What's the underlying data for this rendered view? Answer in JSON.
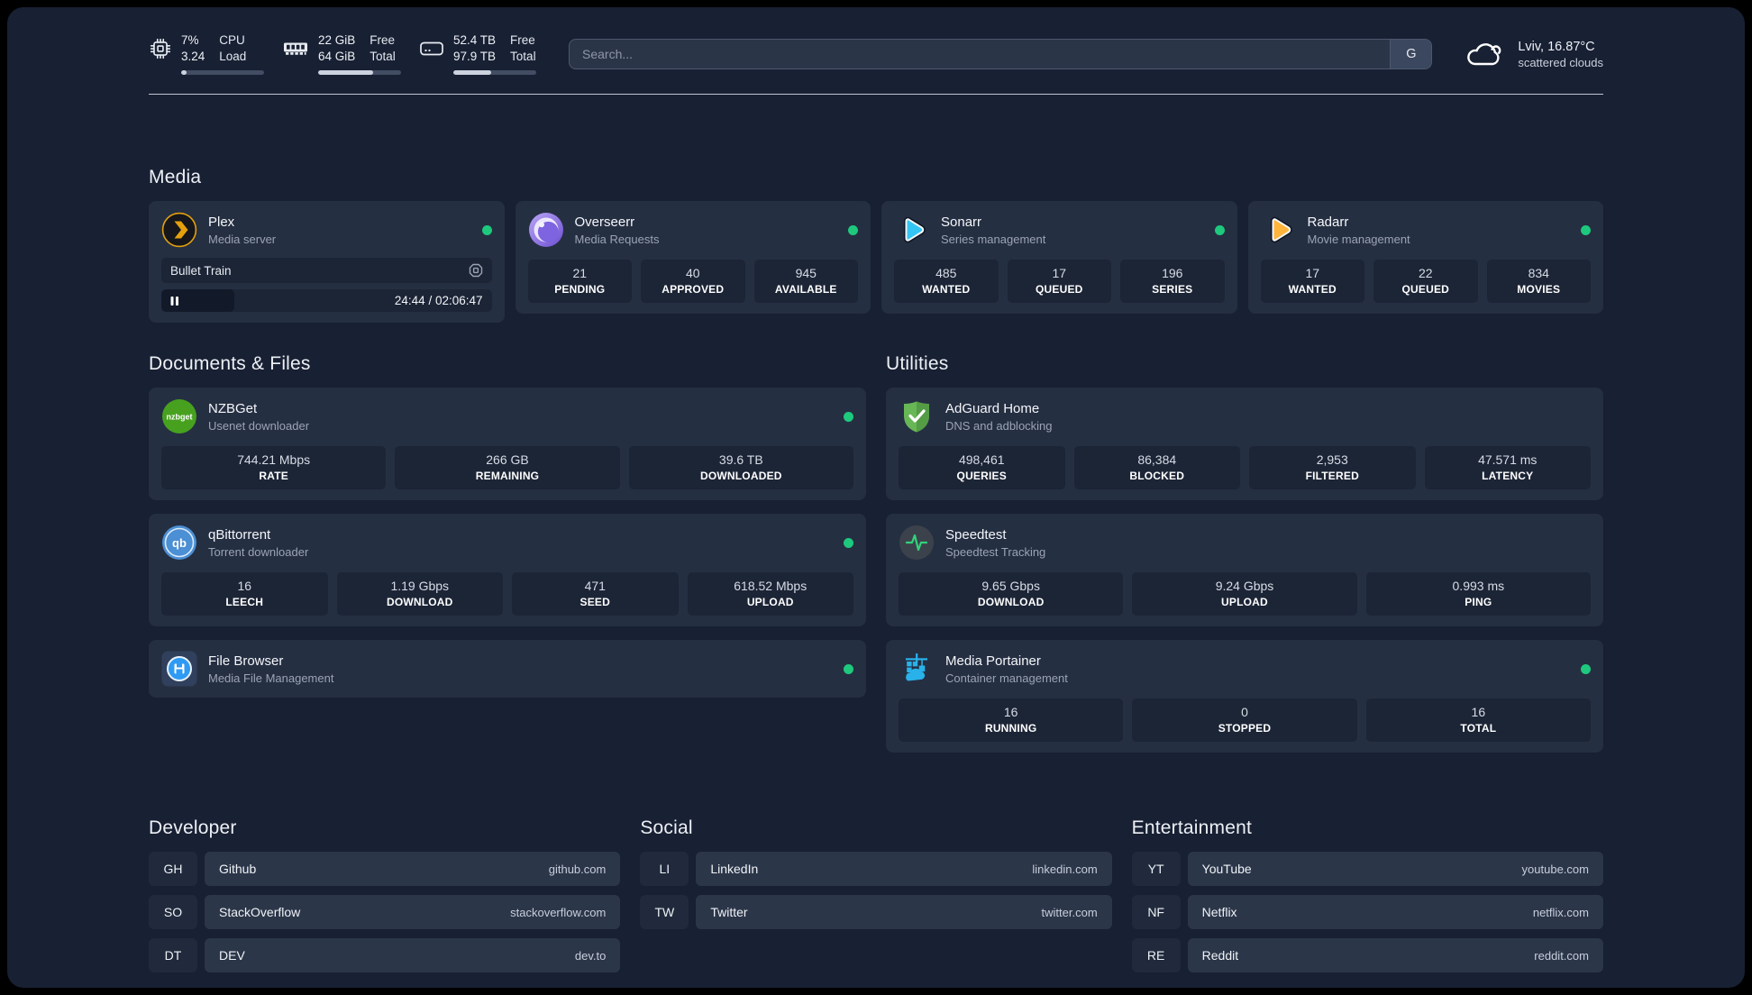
{
  "topbar": {
    "system_stats": [
      {
        "icon": "cpu-icon",
        "value_top": "7%",
        "value_bottom": "3.24",
        "label_top": "CPU",
        "label_bottom": "Load",
        "progress": 7
      },
      {
        "icon": "ram-icon",
        "value_top": "22 GiB",
        "value_bottom": "64 GiB",
        "label_top": "Free",
        "label_bottom": "Total",
        "progress": 66
      },
      {
        "icon": "disk-icon",
        "value_top": "52.4 TB",
        "value_bottom": "97.9 TB",
        "label_top": "Free",
        "label_bottom": "Total",
        "progress": 46
      }
    ],
    "search": {
      "placeholder": "Search...",
      "engine_button": "G"
    },
    "weather": {
      "summary": "Lviv, 16.87°C",
      "condition": "scattered clouds"
    }
  },
  "media": {
    "title": "Media",
    "plex": {
      "name": "Plex",
      "subtitle": "Media server",
      "status": "online",
      "now_playing": "Bullet Train",
      "time_display": "24:44 / 02:06:47",
      "progress_percent": 22
    },
    "overseerr": {
      "name": "Overseerr",
      "subtitle": "Media Requests",
      "status": "online",
      "stats": [
        {
          "value": "21",
          "label": "PENDING"
        },
        {
          "value": "40",
          "label": "APPROVED"
        },
        {
          "value": "945",
          "label": "AVAILABLE"
        }
      ]
    },
    "sonarr": {
      "name": "Sonarr",
      "subtitle": "Series management",
      "status": "online",
      "stats": [
        {
          "value": "485",
          "label": "WANTED"
        },
        {
          "value": "17",
          "label": "QUEUED"
        },
        {
          "value": "196",
          "label": "SERIES"
        }
      ]
    },
    "radarr": {
      "name": "Radarr",
      "subtitle": "Movie management",
      "status": "online",
      "stats": [
        {
          "value": "17",
          "label": "WANTED"
        },
        {
          "value": "22",
          "label": "QUEUED"
        },
        {
          "value": "834",
          "label": "MOVIES"
        }
      ]
    }
  },
  "documents": {
    "title": "Documents & Files",
    "nzbget": {
      "name": "NZBGet",
      "subtitle": "Usenet downloader",
      "status": "online",
      "stats": [
        {
          "value": "744.21 Mbps",
          "label": "RATE"
        },
        {
          "value": "266 GB",
          "label": "REMAINING"
        },
        {
          "value": "39.6 TB",
          "label": "DOWNLOADED"
        }
      ]
    },
    "qbittorrent": {
      "name": "qBittorrent",
      "subtitle": "Torrent downloader",
      "status": "online",
      "stats": [
        {
          "value": "16",
          "label": "LEECH"
        },
        {
          "value": "1.19 Gbps",
          "label": "DOWNLOAD"
        },
        {
          "value": "471",
          "label": "SEED"
        },
        {
          "value": "618.52 Mbps",
          "label": "UPLOAD"
        }
      ]
    },
    "filebrowser": {
      "name": "File Browser",
      "subtitle": "Media File Management",
      "status": "online"
    }
  },
  "utilities": {
    "title": "Utilities",
    "adguard": {
      "name": "AdGuard Home",
      "subtitle": "DNS and adblocking",
      "stats": [
        {
          "value": "498,461",
          "label": "QUERIES"
        },
        {
          "value": "86,384",
          "label": "BLOCKED"
        },
        {
          "value": "2,953",
          "label": "FILTERED"
        },
        {
          "value": "47.571 ms",
          "label": "LATENCY"
        }
      ]
    },
    "speedtest": {
      "name": "Speedtest",
      "subtitle": "Speedtest Tracking",
      "stats": [
        {
          "value": "9.65 Gbps",
          "label": "DOWNLOAD"
        },
        {
          "value": "9.24 Gbps",
          "label": "UPLOAD"
        },
        {
          "value": "0.993 ms",
          "label": "PING"
        }
      ]
    },
    "portainer": {
      "name": "Media Portainer",
      "subtitle": "Container management",
      "status": "online",
      "stats": [
        {
          "value": "16",
          "label": "RUNNING"
        },
        {
          "value": "0",
          "label": "STOPPED"
        },
        {
          "value": "16",
          "label": "TOTAL"
        }
      ]
    }
  },
  "links": {
    "developer": {
      "title": "Developer",
      "items": [
        {
          "abbr": "GH",
          "name": "Github",
          "url": "github.com"
        },
        {
          "abbr": "SO",
          "name": "StackOverflow",
          "url": "stackoverflow.com"
        },
        {
          "abbr": "DT",
          "name": "DEV",
          "url": "dev.to"
        }
      ]
    },
    "social": {
      "title": "Social",
      "items": [
        {
          "abbr": "LI",
          "name": "LinkedIn",
          "url": "linkedin.com"
        },
        {
          "abbr": "TW",
          "name": "Twitter",
          "url": "twitter.com"
        }
      ]
    },
    "entertainment": {
      "title": "Entertainment",
      "items": [
        {
          "abbr": "YT",
          "name": "YouTube",
          "url": "youtube.com"
        },
        {
          "abbr": "NF",
          "name": "Netflix",
          "url": "netflix.com"
        },
        {
          "abbr": "RE",
          "name": "Reddit",
          "url": "reddit.com"
        }
      ]
    }
  },
  "colors": {
    "status_online": "#1ec97e",
    "plex_amber": "#e5a00d",
    "sonarr_blue": "#35c5f4",
    "radarr_amber": "#ffb53c"
  }
}
